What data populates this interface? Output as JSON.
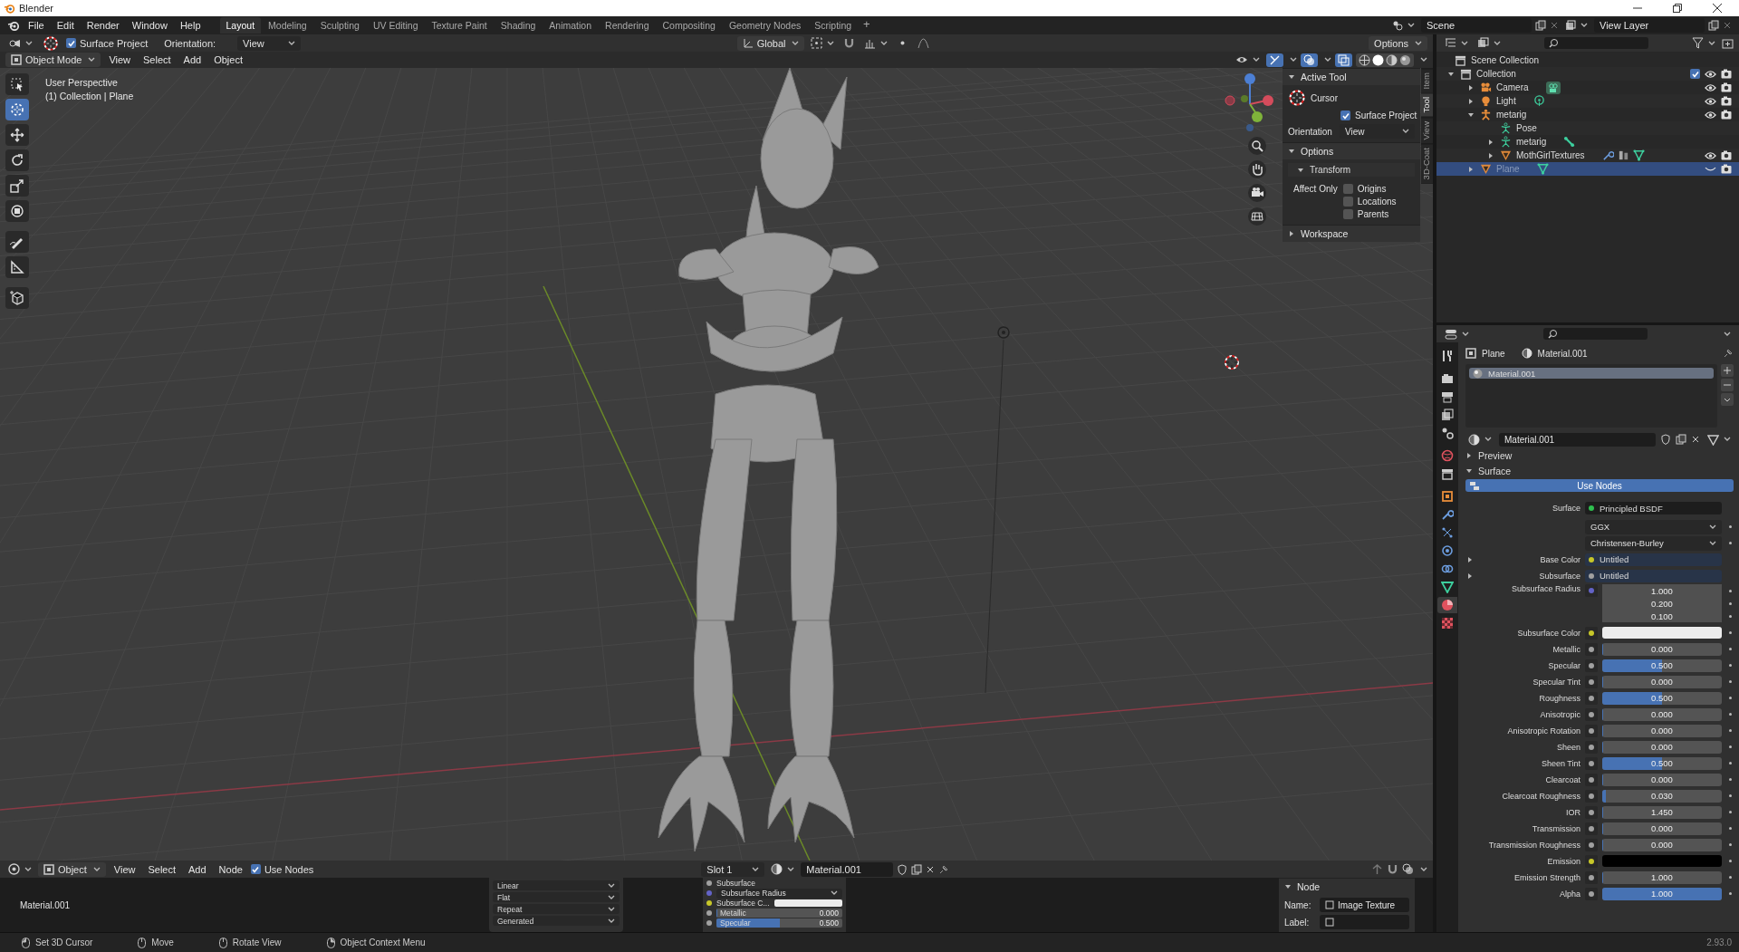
{
  "window": {
    "title": "Blender"
  },
  "menus": [
    "File",
    "Edit",
    "Render",
    "Window",
    "Help"
  ],
  "workspaces": [
    {
      "label": "Layout",
      "selected": true
    },
    {
      "label": "Modeling",
      "selected": false
    },
    {
      "label": "Sculpting",
      "selected": false
    },
    {
      "label": "UV Editing",
      "selected": false
    },
    {
      "label": "Texture Paint",
      "selected": false
    },
    {
      "label": "Shading",
      "selected": false
    },
    {
      "label": "Animation",
      "selected": false
    },
    {
      "label": "Rendering",
      "selected": false
    },
    {
      "label": "Compositing",
      "selected": false
    },
    {
      "label": "Geometry Nodes",
      "selected": false
    },
    {
      "label": "Scripting",
      "selected": false
    }
  ],
  "add_workspace": "+",
  "scene": "Scene",
  "view_layer": "View Layer",
  "tool_header": {
    "surface_project": {
      "label": "Surface Project",
      "checked": true
    },
    "orientation_label": "Orientation:",
    "orientation": "View",
    "transform": "Global",
    "options": "Options"
  },
  "viewport_header": {
    "mode": "Object Mode",
    "menus": [
      "View",
      "Select",
      "Add",
      "Object"
    ]
  },
  "viewport": {
    "perspective": "User Perspective",
    "context": "(1) Collection | Plane"
  },
  "toolbar": [
    {
      "kind": "select",
      "selected": false
    },
    {
      "kind": "cursor",
      "selected": true
    },
    {
      "kind": "move",
      "selected": false
    },
    {
      "kind": "rotate",
      "selected": false
    },
    {
      "kind": "scale",
      "selected": false
    },
    {
      "kind": "transform",
      "selected": false
    },
    {
      "kind": "annotate",
      "selected": false
    },
    {
      "kind": "measure",
      "selected": false
    },
    {
      "kind": "add-cube",
      "selected": false
    }
  ],
  "sidebar": {
    "tabs": [
      {
        "label": "Item",
        "selected": false
      },
      {
        "label": "Tool",
        "selected": true
      },
      {
        "label": "View",
        "selected": false
      },
      {
        "label": "3D-Coat",
        "selected": false
      }
    ],
    "active_tool": {
      "title": "Active Tool",
      "expanded": true,
      "tool": "Cursor",
      "surface_project": {
        "label": "Surface Project",
        "checked": true
      },
      "orientation_label": "Orientation",
      "orientation": "View"
    },
    "options": {
      "title": "Options",
      "expanded": true,
      "transform": {
        "title": "Transform",
        "expanded": true,
        "affect_label": "Affect Only",
        "items": [
          {
            "label": "Origins",
            "checked": false
          },
          {
            "label": "Locations",
            "checked": false
          },
          {
            "label": "Parents",
            "checked": false
          }
        ]
      }
    },
    "workspace": {
      "title": "Workspace",
      "expanded": false
    }
  },
  "outliner": {
    "root": "Scene Collection",
    "items": [
      {
        "label": "Collection",
        "kind": "collection",
        "expanded": true,
        "selected": false,
        "checked": true,
        "visible": true,
        "children": [
          {
            "label": "Camera",
            "kind": "camera",
            "expanded": false,
            "selected": false,
            "visible": true
          },
          {
            "label": "Light",
            "kind": "light",
            "expanded": false,
            "selected": false,
            "visible": true
          },
          {
            "label": "metarig",
            "kind": "armature",
            "expanded": true,
            "selected": false,
            "visible": true,
            "children": [
              {
                "label": "Pose",
                "kind": "pose",
                "selected": false
              },
              {
                "label": "metarig",
                "kind": "armature-data",
                "expanded": false,
                "selected": false
              },
              {
                "label": "MothGirlTextures",
                "kind": "mesh",
                "has_modifiers": true,
                "expanded": false,
                "selected": false,
                "visible": true
              }
            ]
          },
          {
            "label": "Plane",
            "kind": "mesh",
            "has_modifiers": false,
            "expanded": false,
            "selected": true,
            "visible": false
          }
        ]
      }
    ]
  },
  "properties": {
    "tabs": [
      {
        "kind": "tool",
        "selected": false
      },
      {
        "kind": "render",
        "selected": false
      },
      {
        "kind": "output",
        "selected": false
      },
      {
        "kind": "view-layer",
        "selected": false
      },
      {
        "kind": "scene",
        "selected": false
      },
      {
        "kind": "world",
        "selected": false
      },
      {
        "kind": "collection",
        "selected": false
      },
      {
        "kind": "object",
        "selected": false
      },
      {
        "kind": "modifier",
        "selected": false
      },
      {
        "kind": "particles",
        "selected": false
      },
      {
        "kind": "physics",
        "selected": false
      },
      {
        "kind": "constraints",
        "selected": false
      },
      {
        "kind": "data",
        "selected": false
      },
      {
        "kind": "material",
        "selected": true
      },
      {
        "kind": "texture",
        "selected": false
      }
    ],
    "object": "Plane",
    "material": "Material.001",
    "slots": [
      {
        "label": "Material.001",
        "selected": true
      }
    ],
    "material_field": "Material.001",
    "sections": [
      {
        "label": "Preview",
        "expanded": false
      },
      {
        "label": "Surface",
        "expanded": true
      }
    ],
    "use_nodes": "Use Nodes",
    "surface_label": "Surface",
    "surface": "Principled BSDF",
    "distribution": "GGX",
    "subsurface_method": "Christensen-Burley",
    "inputs": [
      {
        "label": "Base Color",
        "kind": "link",
        "color": "#c7c729",
        "value": "Untitled",
        "expandable": true
      },
      {
        "label": "Subsurface",
        "kind": "link",
        "color": "#a1a1a1",
        "value": "Untitled",
        "expandable": true
      },
      {
        "label": "Subsurface Radius",
        "kind": "vector",
        "color": "#6363c7",
        "values": [
          "1.000",
          "0.200",
          "0.100"
        ]
      },
      {
        "label": "Subsurface Color",
        "kind": "white",
        "color": "#c7c729"
      },
      {
        "label": "Metallic",
        "kind": "slider",
        "color": "#a1a1a1",
        "value": "0.000",
        "level": 0
      },
      {
        "label": "Specular",
        "kind": "slider",
        "color": "#a1a1a1",
        "value": "0.500",
        "level": 0.5
      },
      {
        "label": "Specular Tint",
        "kind": "slider",
        "color": "#a1a1a1",
        "value": "0.000",
        "level": 0
      },
      {
        "label": "Roughness",
        "kind": "slider",
        "color": "#a1a1a1",
        "value": "0.500",
        "level": 0.5
      },
      {
        "label": "Anisotropic",
        "kind": "slider",
        "color": "#a1a1a1",
        "value": "0.000",
        "level": 0
      },
      {
        "label": "Anisotropic Rotation",
        "kind": "slider",
        "color": "#a1a1a1",
        "value": "0.000",
        "level": 0
      },
      {
        "label": "Sheen",
        "kind": "slider",
        "color": "#a1a1a1",
        "value": "0.000",
        "level": 0
      },
      {
        "label": "Sheen Tint",
        "kind": "slider",
        "color": "#a1a1a1",
        "value": "0.500",
        "level": 0.5
      },
      {
        "label": "Clearcoat",
        "kind": "slider",
        "color": "#a1a1a1",
        "value": "0.000",
        "level": 0
      },
      {
        "label": "Clearcoat Roughness",
        "kind": "slider",
        "color": "#a1a1a1",
        "value": "0.030",
        "level": 0.03
      },
      {
        "label": "IOR",
        "kind": "slider",
        "color": "#a1a1a1",
        "value": "1.450",
        "level": 0
      },
      {
        "label": "Transmission",
        "kind": "slider",
        "color": "#a1a1a1",
        "value": "0.000",
        "level": 0
      },
      {
        "label": "Transmission Roughness",
        "kind": "slider",
        "color": "#a1a1a1",
        "value": "0.000",
        "level": 0
      },
      {
        "label": "Emission",
        "kind": "black",
        "color": "#c7c729"
      },
      {
        "label": "Emission Strength",
        "kind": "slider",
        "color": "#a1a1a1",
        "value": "1.000",
        "level": 0
      },
      {
        "label": "Alpha",
        "kind": "slider",
        "color": "#a1a1a1",
        "value": "1.000",
        "level": 1
      }
    ]
  },
  "node_editor": {
    "header": {
      "object": "Object",
      "menus": [
        "View",
        "Select",
        "Add",
        "Node"
      ],
      "use_nodes": {
        "label": "Use Nodes",
        "checked": true
      },
      "slot": "Slot 1",
      "material": "Material.001"
    },
    "material_label": "Material.001",
    "image_node": {
      "options": [
        "Linear",
        "Flat",
        "Repeat",
        "Generated"
      ]
    },
    "bsdf_node": {
      "rows": [
        {
          "label": "Subsurface",
          "kind": "socket",
          "color": "#a1a1a1"
        },
        {
          "label": "Subsurface Radius",
          "kind": "dropdown",
          "color": "#6363c7"
        },
        {
          "label": "Subsurface C...",
          "kind": "white",
          "color": "#c7c729"
        },
        {
          "label": "Metallic",
          "kind": "slider",
          "color": "#a1a1a1",
          "value": "0.000",
          "level": 0
        },
        {
          "label": "Specular",
          "kind": "slider",
          "color": "#a1a1a1",
          "value": "0.500",
          "level": 0.5
        }
      ]
    },
    "sidebar": {
      "tab": "Node",
      "name_label": "Name:",
      "name": "Image Texture",
      "label_label": "Label:"
    }
  },
  "status_bar": {
    "items": [
      "Set 3D Cursor",
      "Move",
      "Rotate View",
      "Object Context Menu"
    ],
    "version": "2.93.0"
  }
}
